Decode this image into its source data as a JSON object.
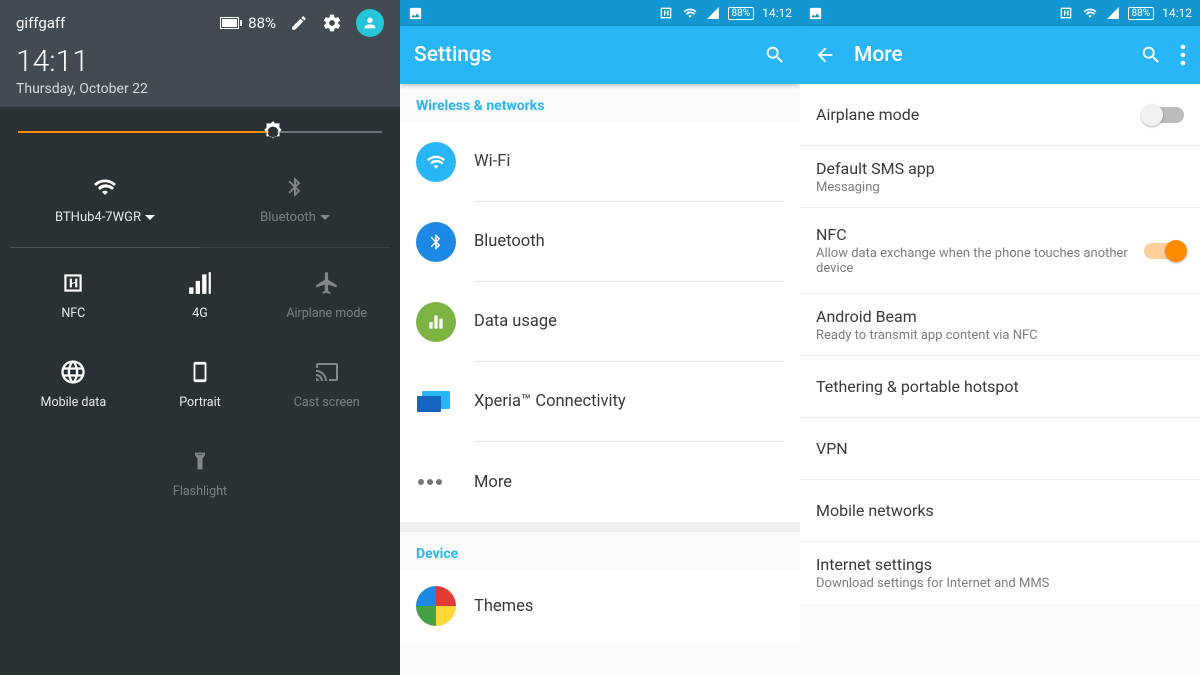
{
  "qs": {
    "carrier": "giffgaff",
    "battery": "88%",
    "time": "14:11",
    "date": "Thursday, October 22",
    "wifi_ssid": "BTHub4-7WGR",
    "bt_label": "Bluetooth",
    "tiles": {
      "nfc": "NFC",
      "signal": "4G",
      "airplane": "Airplane mode",
      "mobiledata": "Mobile data",
      "portrait": "Portrait",
      "cast": "Cast screen",
      "flash": "Flashlight"
    }
  },
  "settings": {
    "statusbar": {
      "battery": "88%",
      "time": "14:12"
    },
    "title": "Settings",
    "section_wireless": "Wireless & networks",
    "section_device": "Device",
    "items": {
      "wifi": "Wi-Fi",
      "bt": "Bluetooth",
      "data": "Data usage",
      "xperia": "Xperia™ Connectivity",
      "more": "More",
      "themes": "Themes"
    }
  },
  "more": {
    "statusbar": {
      "battery": "88%",
      "time": "14:12"
    },
    "title": "More",
    "items": {
      "airplane": {
        "title": "Airplane mode"
      },
      "sms": {
        "title": "Default SMS app",
        "sub": "Messaging"
      },
      "nfc": {
        "title": "NFC",
        "sub": "Allow data exchange when the phone touches another device"
      },
      "beam": {
        "title": "Android Beam",
        "sub": "Ready to transmit app content via NFC"
      },
      "tether": {
        "title": "Tethering & portable hotspot"
      },
      "vpn": {
        "title": "VPN"
      },
      "mobile": {
        "title": "Mobile networks"
      },
      "internet": {
        "title": "Internet settings",
        "sub": "Download settings for Internet and MMS"
      }
    }
  }
}
